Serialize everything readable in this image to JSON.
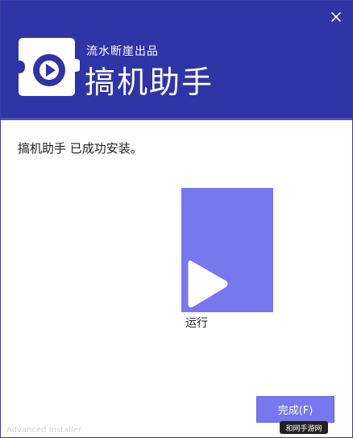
{
  "header": {
    "tagline": "流水断崖出品",
    "app_name": "搞机助手",
    "logo_icon": "puzzle-piece-icon",
    "close_icon": "close-icon",
    "background_color": "#2f34a6"
  },
  "main": {
    "status_message": "搞机助手 已成功安装。",
    "run_button": {
      "label": "运行",
      "icon": "play-icon",
      "color": "#7777ee"
    }
  },
  "footer": {
    "watermark": "Advanced Installer",
    "finish_button_label": "完成(F)",
    "badge_text": "和网手游网"
  }
}
